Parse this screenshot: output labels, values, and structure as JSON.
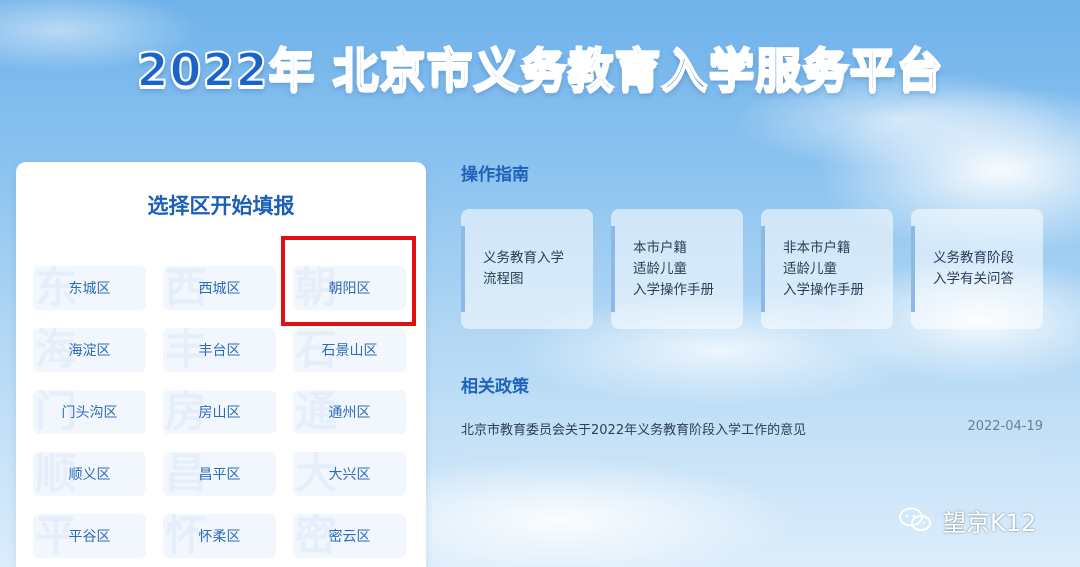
{
  "page": {
    "title": "2022年 北京市义务教育入学服务平台"
  },
  "district_panel": {
    "title": "选择区开始填报",
    "districts": [
      {
        "label": "东城区",
        "ghost": "东"
      },
      {
        "label": "西城区",
        "ghost": "西"
      },
      {
        "label": "朝阳区",
        "ghost": "朝"
      },
      {
        "label": "海淀区",
        "ghost": "海"
      },
      {
        "label": "丰台区",
        "ghost": "丰"
      },
      {
        "label": "石景山区",
        "ghost": "石"
      },
      {
        "label": "门头沟区",
        "ghost": "门"
      },
      {
        "label": "房山区",
        "ghost": "房"
      },
      {
        "label": "通州区",
        "ghost": "通"
      },
      {
        "label": "顺义区",
        "ghost": "顺"
      },
      {
        "label": "昌平区",
        "ghost": "昌"
      },
      {
        "label": "大兴区",
        "ghost": "大"
      },
      {
        "label": "平谷区",
        "ghost": "平"
      },
      {
        "label": "怀柔区",
        "ghost": "怀"
      },
      {
        "label": "密云区",
        "ghost": "密"
      }
    ],
    "highlight_color": "#e01010"
  },
  "guide": {
    "title": "操作指南",
    "cards": [
      {
        "text": "义务教育入学\n流程图"
      },
      {
        "text": "本市户籍\n适龄儿童\n入学操作手册"
      },
      {
        "text": "非本市户籍\n适龄儿童\n入学操作手册"
      },
      {
        "text": "义务教育阶段\n入学有关问答"
      }
    ]
  },
  "policy": {
    "title": "相关政策",
    "items": [
      {
        "title": "北京市教育委员会关于2022年义务教育阶段入学工作的意见",
        "date": "2022-04-19"
      }
    ]
  },
  "watermark": {
    "text": "望京K12",
    "icon": "wechat-icon"
  },
  "colors": {
    "brand_blue": "#1b63c6",
    "link_blue": "#2c6cb8",
    "sky_top": "#6fb2ea"
  }
}
